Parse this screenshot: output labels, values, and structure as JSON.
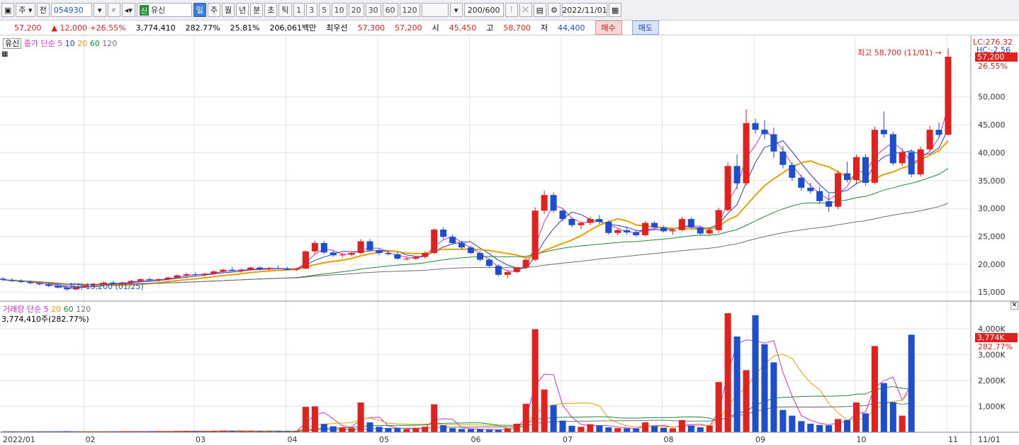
{
  "toolbar": {
    "market_label": "주",
    "period_label": "전",
    "stock_code": "054930",
    "xin_badge": "신",
    "stock_name": "유신",
    "tabs": [
      "일",
      "주",
      "월",
      "년",
      "분",
      "초",
      "틱"
    ],
    "selected_tab": "일",
    "numbers": [
      "1",
      "3",
      "5",
      "10",
      "20",
      "30",
      "60",
      "120"
    ],
    "count": "200/600",
    "date": "2022/11/01"
  },
  "quote": {
    "price": "57,200",
    "change": "12,000",
    "change_pct": "+26.55%",
    "volume": "3,774,410",
    "volume_ratio": "282.77%",
    "turnover": "25.81%",
    "amount": "206,061백만",
    "best_label": "최우선",
    "best_ask": "57,300",
    "best_bid": "57,200",
    "open_label": "시",
    "open": "45,450",
    "high_label": "고",
    "high": "58,700",
    "low_label": "저",
    "low": "44,400",
    "buy_label": "매수",
    "sell_label": "매도"
  },
  "price_panel": {
    "stock_tag": "유신",
    "ma_title": "종가 단순",
    "ma_periods": [
      "5",
      "10",
      "20",
      "60",
      "120"
    ],
    "ma_colors": [
      "#c832c8",
      "#1e3cc8",
      "#e8a000",
      "#1a8a3a",
      "#707070"
    ],
    "lc": "LC:276.32",
    "hc": "HC:-2.56",
    "price_badge": "57,200",
    "pct_label": "26.55%",
    "high_annot": "최고 58,700 (11/01)",
    "low_annot": "최저 15,200 (01/25)",
    "y_ticks": [
      "50,000",
      "45,000",
      "40,000",
      "35,000",
      "30,000",
      "25,000",
      "20,000",
      "15,000"
    ]
  },
  "volume_panel": {
    "title": "거래량",
    "ma_title": "단순",
    "ma_periods": [
      "5",
      "20",
      "60",
      "120"
    ],
    "value_label": "3,774,410주(282.77%)",
    "badge": "3,774K",
    "badge_pct": "282.77%",
    "y_ticks": [
      "4,000K",
      "3,000K",
      "2,000K",
      "1,000K"
    ]
  },
  "x_axis": {
    "labels": [
      "2022/01",
      "02",
      "03",
      "04",
      "05",
      "06",
      "07",
      "08",
      "09",
      "10",
      "11",
      "11/01"
    ]
  },
  "colors": {
    "up": "#e0211d",
    "down": "#1e4ecc",
    "grid": "#e3e3e3"
  },
  "chart_data": {
    "type": "candlestick",
    "price_ylim": [
      13500,
      60000
    ],
    "volume_ylim": [
      0,
      4600
    ],
    "volume_unit": "K",
    "candles": [
      [
        17400,
        17700,
        17000,
        17200
      ],
      [
        17200,
        17500,
        16800,
        17000
      ],
      [
        17000,
        17300,
        16600,
        16800
      ],
      [
        16800,
        17100,
        16400,
        16600
      ],
      [
        16600,
        16900,
        16200,
        16400
      ],
      [
        16400,
        16700,
        15900,
        16100
      ],
      [
        16100,
        16400,
        15600,
        15800
      ],
      [
        15800,
        16000,
        15200,
        15500
      ],
      [
        15500,
        16100,
        15300,
        15900
      ],
      [
        15900,
        16400,
        15700,
        16200
      ],
      [
        16200,
        16600,
        15900,
        16400
      ],
      [
        16400,
        16900,
        16100,
        16700
      ],
      [
        16700,
        17000,
        16300,
        16500
      ],
      [
        16500,
        16900,
        16200,
        16700
      ],
      [
        16700,
        17200,
        16500,
        17000
      ],
      [
        17000,
        17500,
        16800,
        17300
      ],
      [
        17300,
        17600,
        16900,
        17100
      ],
      [
        17100,
        17500,
        16900,
        17300
      ],
      [
        17300,
        17800,
        17100,
        17600
      ],
      [
        17600,
        18200,
        17400,
        18000
      ],
      [
        18000,
        18500,
        17700,
        18200
      ],
      [
        18200,
        18600,
        17900,
        18100
      ],
      [
        18100,
        18500,
        17800,
        18300
      ],
      [
        18300,
        18900,
        18100,
        18700
      ],
      [
        18700,
        19200,
        18500,
        19000
      ],
      [
        19000,
        19500,
        18700,
        18800
      ],
      [
        18800,
        19200,
        18500,
        19000
      ],
      [
        19000,
        19600,
        18800,
        19400
      ],
      [
        19400,
        19600,
        18900,
        19100
      ],
      [
        19100,
        19500,
        18900,
        19300
      ],
      [
        19300,
        19800,
        19100,
        19200
      ],
      [
        19200,
        19500,
        18900,
        19000
      ],
      [
        19000,
        19400,
        18800,
        19200
      ],
      [
        19200,
        22500,
        19100,
        22300
      ],
      [
        22300,
        24200,
        21800,
        23800
      ],
      [
        23800,
        24200,
        21800,
        22100
      ],
      [
        22100,
        22500,
        21300,
        21600
      ],
      [
        21600,
        22000,
        21200,
        21700
      ],
      [
        21700,
        22300,
        21400,
        22000
      ],
      [
        22000,
        24500,
        21800,
        24100
      ],
      [
        24100,
        24500,
        22300,
        22500
      ],
      [
        22500,
        22800,
        21600,
        22000
      ],
      [
        22000,
        22400,
        21600,
        21800
      ],
      [
        21800,
        22200,
        20800,
        21000
      ],
      [
        21000,
        21400,
        20600,
        21000
      ],
      [
        21000,
        21500,
        20700,
        21300
      ],
      [
        21300,
        22300,
        21000,
        22000
      ],
      [
        22000,
        26400,
        21800,
        26200
      ],
      [
        26200,
        26600,
        24500,
        24900
      ],
      [
        24900,
        25300,
        23500,
        23800
      ],
      [
        23800,
        24200,
        22600,
        23000
      ],
      [
        23000,
        23300,
        21800,
        22000
      ],
      [
        22000,
        22300,
        20500,
        20800
      ],
      [
        20800,
        21100,
        19400,
        19700
      ],
      [
        19700,
        20000,
        17800,
        18100
      ],
      [
        18100,
        18900,
        17500,
        18600
      ],
      [
        18600,
        19600,
        18400,
        19400
      ],
      [
        19400,
        21000,
        19100,
        20800
      ],
      [
        20800,
        30200,
        20500,
        29600
      ],
      [
        29600,
        33200,
        29000,
        32400
      ],
      [
        32400,
        32900,
        29200,
        29600
      ],
      [
        29600,
        29900,
        27700,
        28100
      ],
      [
        28100,
        28400,
        26600,
        27000
      ],
      [
        27000,
        27600,
        26300,
        27400
      ],
      [
        27400,
        28500,
        27000,
        28100
      ],
      [
        28100,
        28800,
        27200,
        27600
      ],
      [
        27600,
        27900,
        25300,
        25600
      ],
      [
        25600,
        26400,
        25200,
        26100
      ],
      [
        26100,
        26700,
        25300,
        25700
      ],
      [
        25700,
        26100,
        24900,
        25200
      ],
      [
        25200,
        27700,
        25000,
        27400
      ],
      [
        27400,
        27700,
        26300,
        26600
      ],
      [
        26600,
        26900,
        25700,
        25900
      ],
      [
        25900,
        26400,
        25300,
        26100
      ],
      [
        26100,
        28500,
        25900,
        28100
      ],
      [
        28100,
        28400,
        26300,
        26600
      ],
      [
        26600,
        26900,
        25200,
        25500
      ],
      [
        25500,
        26400,
        25200,
        26100
      ],
      [
        26100,
        30100,
        25600,
        29700
      ],
      [
        29700,
        38200,
        29400,
        37600
      ],
      [
        37600,
        39700,
        33400,
        34500
      ],
      [
        34500,
        47800,
        34100,
        45300
      ],
      [
        45300,
        46100,
        43400,
        44100
      ],
      [
        44100,
        45800,
        42400,
        43300
      ],
      [
        43300,
        44500,
        39100,
        40200
      ],
      [
        40200,
        41200,
        37200,
        37800
      ],
      [
        37800,
        38300,
        34900,
        35500
      ],
      [
        35500,
        36100,
        33100,
        33700
      ],
      [
        33700,
        34600,
        32700,
        33100
      ],
      [
        33100,
        33900,
        30800,
        31300
      ],
      [
        31300,
        32600,
        29400,
        30300
      ],
      [
        30300,
        36800,
        29900,
        36300
      ],
      [
        36300,
        38400,
        34700,
        35100
      ],
      [
        35100,
        39700,
        34300,
        39200
      ],
      [
        39200,
        39700,
        34100,
        34600
      ],
      [
        34600,
        44700,
        34300,
        44100
      ],
      [
        44100,
        47400,
        42700,
        43300
      ],
      [
        43300,
        43700,
        37700,
        38100
      ],
      [
        38100,
        40700,
        37600,
        40100
      ],
      [
        40100,
        40600,
        35600,
        36100
      ],
      [
        36100,
        41100,
        35700,
        40600
      ],
      [
        40600,
        44800,
        40300,
        44100
      ],
      [
        44100,
        45400,
        42700,
        43200
      ],
      [
        43200,
        58700,
        43100,
        57200
      ]
    ],
    "volume_k": [
      20,
      18,
      16,
      22,
      25,
      30,
      28,
      35,
      20,
      18,
      22,
      25,
      30,
      35,
      28,
      25,
      40,
      32,
      35,
      45,
      50,
      38,
      42,
      55,
      60,
      48,
      45,
      52,
      40,
      38,
      42,
      36,
      45,
      980,
      1000,
      320,
      230,
      190,
      160,
      1150,
      380,
      210,
      160,
      140,
      120,
      160,
      210,
      1080,
      270,
      160,
      130,
      120,
      110,
      95,
      85,
      150,
      330,
      1100,
      3980,
      1650,
      1050,
      450,
      250,
      210,
      310,
      260,
      190,
      160,
      150,
      140,
      380,
      240,
      170,
      150,
      470,
      260,
      190,
      260,
      1940,
      4600,
      3700,
      2400,
      4520,
      3400,
      2700,
      860,
      640,
      430,
      330,
      280,
      270,
      510,
      470,
      1150,
      730,
      3330,
      1900,
      1160,
      640,
      3770
    ],
    "ma_series": [
      "MA5",
      "MA10",
      "MA20",
      "MA60",
      "MA120"
    ]
  }
}
